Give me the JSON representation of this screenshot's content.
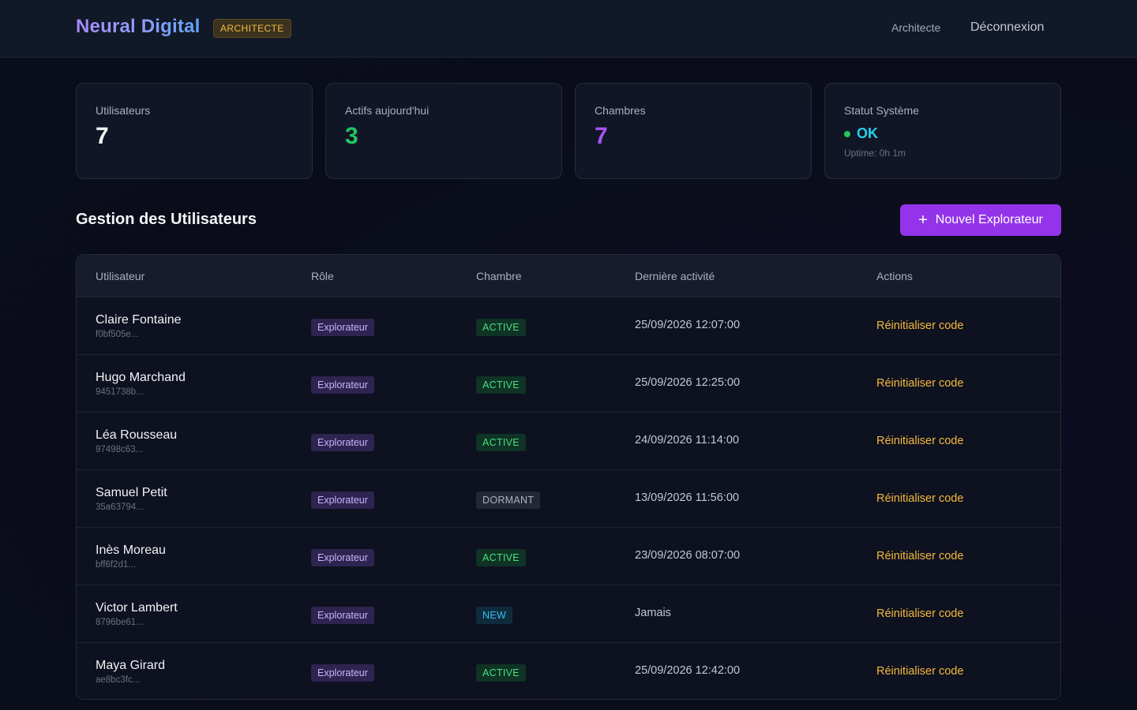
{
  "header": {
    "brand": "Neural Digital",
    "role_badge": "ARCHITECTE",
    "user_label": "Architecte",
    "logout_label": "Déconnexion"
  },
  "stats": {
    "users": {
      "label": "Utilisateurs",
      "value": "7",
      "color": "#f3f4f6"
    },
    "active_today": {
      "label": "Actifs aujourd'hui",
      "value": "3",
      "color": "#22c55e"
    },
    "rooms": {
      "label": "Chambres",
      "value": "7",
      "color": "#a855f7"
    },
    "system": {
      "label": "Statut Système",
      "status": "OK",
      "uptime": "Uptime: 0h 1m"
    }
  },
  "section": {
    "title": "Gestion des Utilisateurs",
    "new_button_icon": "plus-icon",
    "new_button_label": "Nouvel Explorateur"
  },
  "table": {
    "headers": [
      "Utilisateur",
      "Rôle",
      "Chambre",
      "Dernière activité",
      "Actions"
    ],
    "rows": [
      {
        "name": "Claire Fontaine",
        "id": "f0bf505e...",
        "role": "Explorateur",
        "state": "ACTIVE",
        "last": "25/09/2026 12:07:00",
        "action": "Réinitialiser code"
      },
      {
        "name": "Hugo Marchand",
        "id": "9451738b...",
        "role": "Explorateur",
        "state": "ACTIVE",
        "last": "25/09/2026 12:25:00",
        "action": "Réinitialiser code"
      },
      {
        "name": "Léa Rousseau",
        "id": "97498c63...",
        "role": "Explorateur",
        "state": "ACTIVE",
        "last": "24/09/2026 11:14:00",
        "action": "Réinitialiser code"
      },
      {
        "name": "Samuel Petit",
        "id": "35a63794...",
        "role": "Explorateur",
        "state": "DORMANT",
        "last": "13/09/2026 11:56:00",
        "action": "Réinitialiser code"
      },
      {
        "name": "Inès Moreau",
        "id": "bff6f2d1...",
        "role": "Explorateur",
        "state": "ACTIVE",
        "last": "23/09/2026 08:07:00",
        "action": "Réinitialiser code"
      },
      {
        "name": "Victor Lambert",
        "id": "8796be61...",
        "role": "Explorateur",
        "state": "NEW",
        "last": "Jamais",
        "action": "Réinitialiser code"
      },
      {
        "name": "Maya Girard",
        "id": "ae8bc3fc...",
        "role": "Explorateur",
        "state": "ACTIVE",
        "last": "25/09/2026 12:42:00",
        "action": "Réinitialiser code"
      }
    ]
  }
}
